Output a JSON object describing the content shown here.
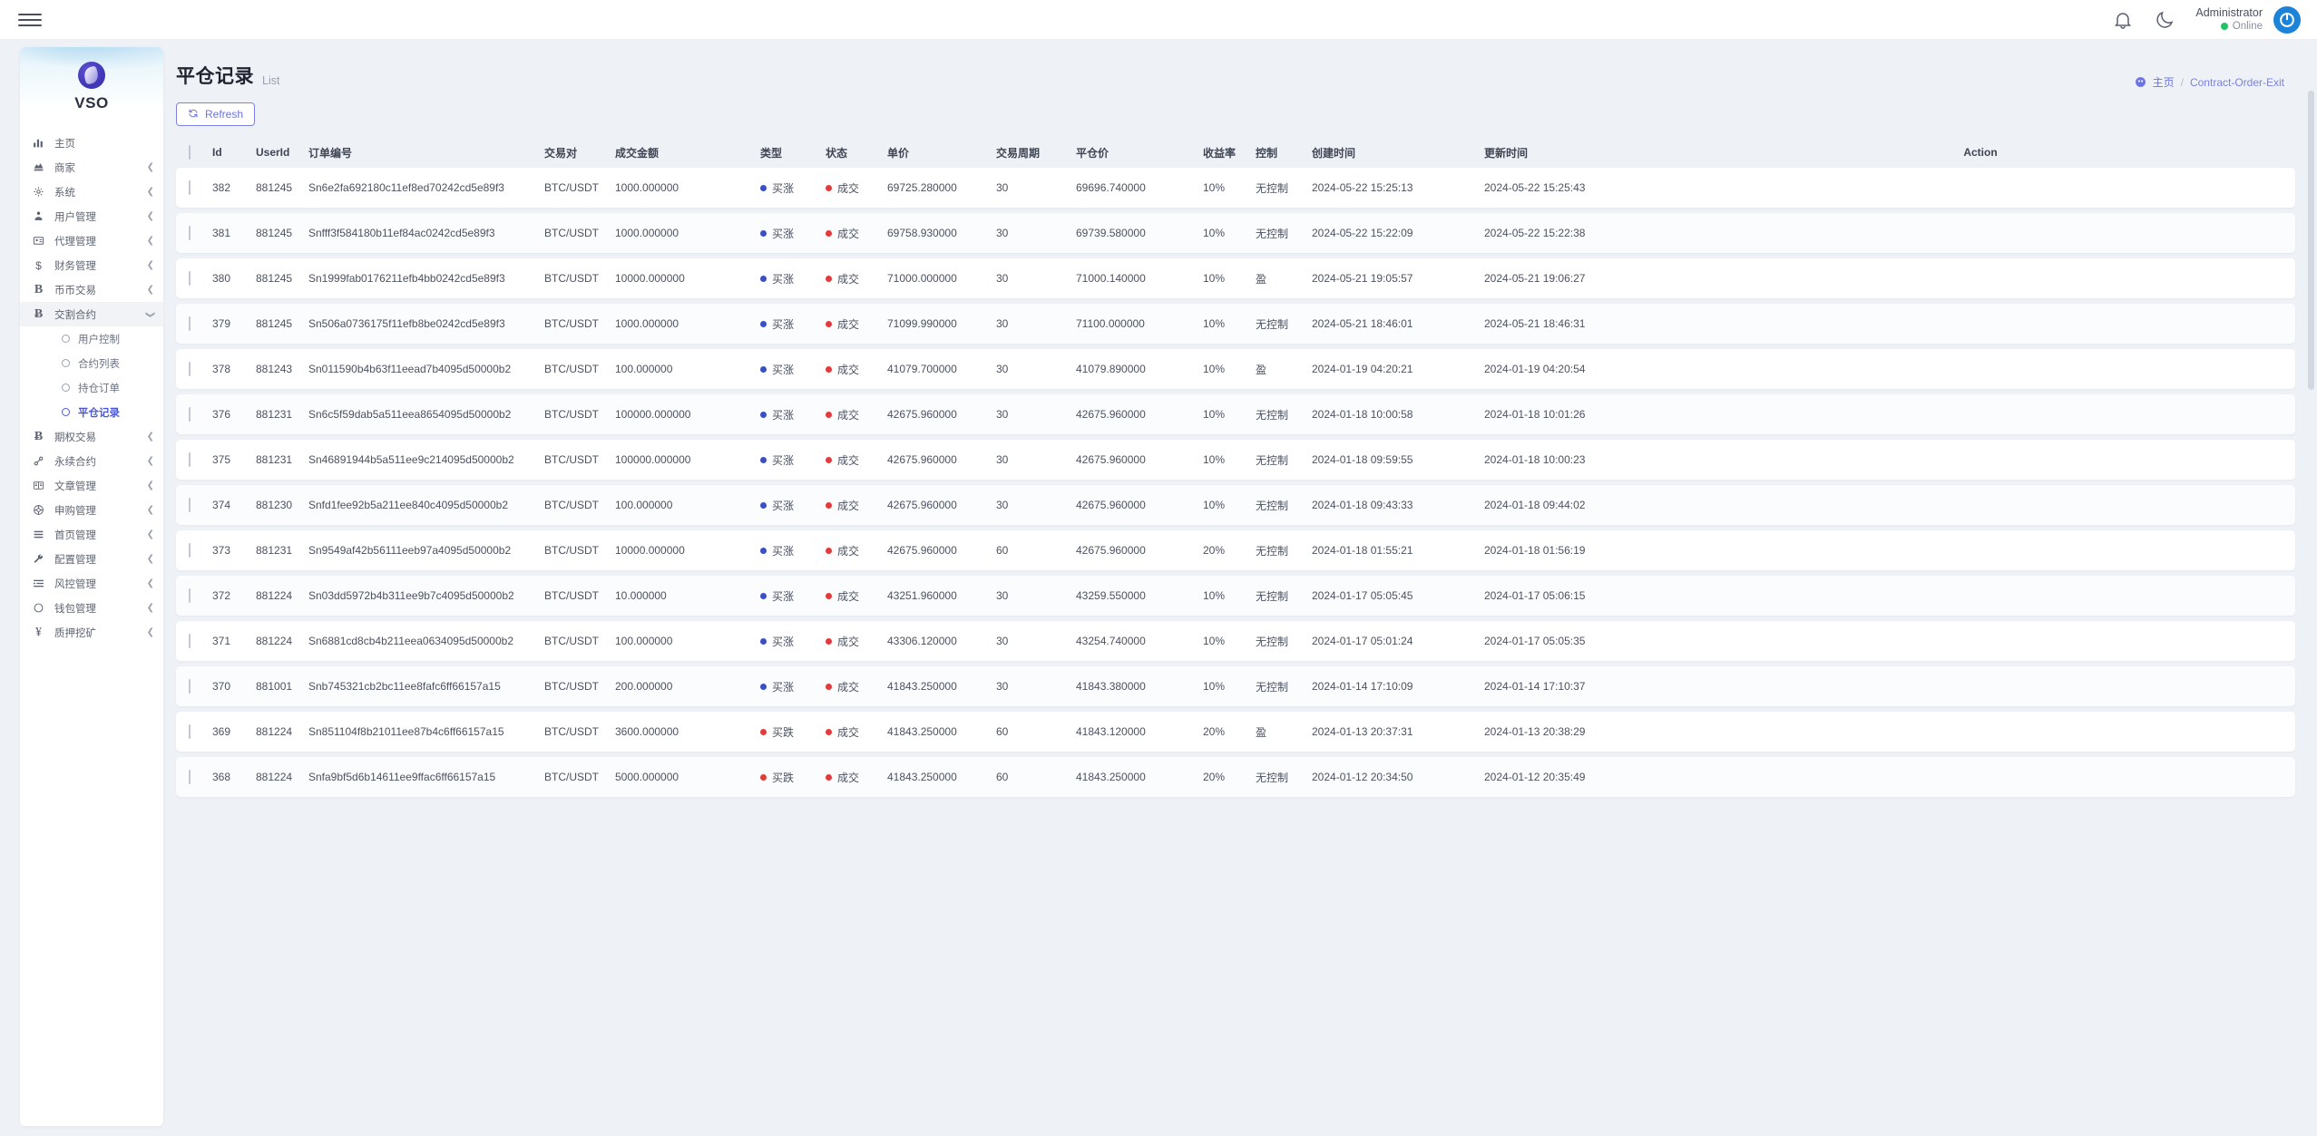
{
  "topbar": {
    "menu_toggle": "menu-toggle",
    "notification_icon": "bell-icon",
    "theme_icon": "moon-icon",
    "user_name": "Administrator",
    "user_status": "Online"
  },
  "sidebar": {
    "brand_name": "VSO",
    "items": [
      {
        "label": "主页",
        "icon": "chart-bars-icon",
        "caret": false,
        "active": false
      },
      {
        "label": "商家",
        "icon": "merchant-icon",
        "caret": true,
        "active": false
      },
      {
        "label": "系统",
        "icon": "gear-icon",
        "caret": true,
        "active": false
      },
      {
        "label": "用户管理",
        "icon": "user-manage-icon",
        "caret": true,
        "active": false
      },
      {
        "label": "代理管理",
        "icon": "id-card-icon",
        "caret": true,
        "active": false
      },
      {
        "label": "财务管理",
        "icon": "dollar-icon",
        "caret": true,
        "active": false
      },
      {
        "label": "币币交易",
        "icon": "letter-b-icon",
        "caret": true,
        "active": false
      },
      {
        "label": "交割合约",
        "icon": "bitcoin-icon",
        "caret": true,
        "active": true
      },
      {
        "label": "期权交易",
        "icon": "bitcoin-icon",
        "caret": true,
        "active": false
      },
      {
        "label": "永续合约",
        "icon": "link-icon",
        "caret": true,
        "active": false
      },
      {
        "label": "文章管理",
        "icon": "article-icon",
        "caret": true,
        "active": false
      },
      {
        "label": "申购管理",
        "icon": "circle-dot-icon",
        "caret": true,
        "active": false
      },
      {
        "label": "首页管理",
        "icon": "lines-icon",
        "caret": true,
        "active": false
      },
      {
        "label": "配置管理",
        "icon": "wrench-icon",
        "caret": true,
        "active": false
      },
      {
        "label": "风控管理",
        "icon": "list-indent-icon",
        "caret": true,
        "active": false
      },
      {
        "label": "钱包管理",
        "icon": "circle-icon",
        "caret": true,
        "active": false
      },
      {
        "label": "质押挖矿",
        "icon": "yen-icon",
        "caret": true,
        "active": false
      }
    ],
    "submenu": [
      {
        "label": "用户控制",
        "active": false
      },
      {
        "label": "合约列表",
        "active": false
      },
      {
        "label": "持仓订单",
        "active": false
      },
      {
        "label": "平仓记录",
        "active": true
      }
    ]
  },
  "page": {
    "title": "平仓记录",
    "subtitle": "List",
    "breadcrumb_home": "主页",
    "breadcrumb_sep": "/",
    "breadcrumb_current": "Contract-Order-Exit",
    "refresh_label": "Refresh"
  },
  "table": {
    "headers": {
      "id": "Id",
      "user_id": "UserId",
      "order_no": "订单编号",
      "pair": "交易对",
      "amount": "成交金额",
      "type": "类型",
      "state": "状态",
      "price": "单价",
      "period": "交易周期",
      "close_price": "平仓价",
      "rate": "收益率",
      "control": "控制",
      "created": "创建时间",
      "updated": "更新时间",
      "action": "Action"
    },
    "colors": {
      "buy_up": "#3b4fc4",
      "buy_down": "#e23b3b",
      "state_done": "#e23b3b",
      "accent": "#6d74e0"
    },
    "rows": [
      {
        "id": "382",
        "user_id": "881245",
        "order_no": "Sn6e2fa692180c11ef8ed70242cd5e89f3",
        "pair": "BTC/USDT",
        "amount": "1000.000000",
        "type": "买涨",
        "type_dir": "up",
        "state": "成交",
        "price": "69725.280000",
        "period": "30",
        "close_price": "69696.740000",
        "rate": "10%",
        "control": "无控制",
        "created": "2024-05-22 15:25:13",
        "updated": "2024-05-22 15:25:43"
      },
      {
        "id": "381",
        "user_id": "881245",
        "order_no": "Snfff3f584180b11ef84ac0242cd5e89f3",
        "pair": "BTC/USDT",
        "amount": "1000.000000",
        "type": "买涨",
        "type_dir": "up",
        "state": "成交",
        "price": "69758.930000",
        "period": "30",
        "close_price": "69739.580000",
        "rate": "10%",
        "control": "无控制",
        "created": "2024-05-22 15:22:09",
        "updated": "2024-05-22 15:22:38"
      },
      {
        "id": "380",
        "user_id": "881245",
        "order_no": "Sn1999fab0176211efb4bb0242cd5e89f3",
        "pair": "BTC/USDT",
        "amount": "10000.000000",
        "type": "买涨",
        "type_dir": "up",
        "state": "成交",
        "price": "71000.000000",
        "period": "30",
        "close_price": "71000.140000",
        "rate": "10%",
        "control": "盈",
        "created": "2024-05-21 19:05:57",
        "updated": "2024-05-21 19:06:27"
      },
      {
        "id": "379",
        "user_id": "881245",
        "order_no": "Sn506a0736175f11efb8be0242cd5e89f3",
        "pair": "BTC/USDT",
        "amount": "1000.000000",
        "type": "买涨",
        "type_dir": "up",
        "state": "成交",
        "price": "71099.990000",
        "period": "30",
        "close_price": "71100.000000",
        "rate": "10%",
        "control": "无控制",
        "created": "2024-05-21 18:46:01",
        "updated": "2024-05-21 18:46:31"
      },
      {
        "id": "378",
        "user_id": "881243",
        "order_no": "Sn011590b4b63f11eead7b4095d50000b2",
        "pair": "BTC/USDT",
        "amount": "100.000000",
        "type": "买涨",
        "type_dir": "up",
        "state": "成交",
        "price": "41079.700000",
        "period": "30",
        "close_price": "41079.890000",
        "rate": "10%",
        "control": "盈",
        "created": "2024-01-19 04:20:21",
        "updated": "2024-01-19 04:20:54"
      },
      {
        "id": "376",
        "user_id": "881231",
        "order_no": "Sn6c5f59dab5a511eea8654095d50000b2",
        "pair": "BTC/USDT",
        "amount": "100000.000000",
        "type": "买涨",
        "type_dir": "up",
        "state": "成交",
        "price": "42675.960000",
        "period": "30",
        "close_price": "42675.960000",
        "rate": "10%",
        "control": "无控制",
        "created": "2024-01-18 10:00:58",
        "updated": "2024-01-18 10:01:26"
      },
      {
        "id": "375",
        "user_id": "881231",
        "order_no": "Sn46891944b5a511ee9c214095d50000b2",
        "pair": "BTC/USDT",
        "amount": "100000.000000",
        "type": "买涨",
        "type_dir": "up",
        "state": "成交",
        "price": "42675.960000",
        "period": "30",
        "close_price": "42675.960000",
        "rate": "10%",
        "control": "无控制",
        "created": "2024-01-18 09:59:55",
        "updated": "2024-01-18 10:00:23"
      },
      {
        "id": "374",
        "user_id": "881230",
        "order_no": "Snfd1fee92b5a211ee840c4095d50000b2",
        "pair": "BTC/USDT",
        "amount": "100.000000",
        "type": "买涨",
        "type_dir": "up",
        "state": "成交",
        "price": "42675.960000",
        "period": "30",
        "close_price": "42675.960000",
        "rate": "10%",
        "control": "无控制",
        "created": "2024-01-18 09:43:33",
        "updated": "2024-01-18 09:44:02"
      },
      {
        "id": "373",
        "user_id": "881231",
        "order_no": "Sn9549af42b56111eeb97a4095d50000b2",
        "pair": "BTC/USDT",
        "amount": "10000.000000",
        "type": "买涨",
        "type_dir": "up",
        "state": "成交",
        "price": "42675.960000",
        "period": "60",
        "close_price": "42675.960000",
        "rate": "20%",
        "control": "无控制",
        "created": "2024-01-18 01:55:21",
        "updated": "2024-01-18 01:56:19"
      },
      {
        "id": "372",
        "user_id": "881224",
        "order_no": "Sn03dd5972b4b311ee9b7c4095d50000b2",
        "pair": "BTC/USDT",
        "amount": "10.000000",
        "type": "买涨",
        "type_dir": "up",
        "state": "成交",
        "price": "43251.960000",
        "period": "30",
        "close_price": "43259.550000",
        "rate": "10%",
        "control": "无控制",
        "created": "2024-01-17 05:05:45",
        "updated": "2024-01-17 05:06:15"
      },
      {
        "id": "371",
        "user_id": "881224",
        "order_no": "Sn6881cd8cb4b211eea0634095d50000b2",
        "pair": "BTC/USDT",
        "amount": "100.000000",
        "type": "买涨",
        "type_dir": "up",
        "state": "成交",
        "price": "43306.120000",
        "period": "30",
        "close_price": "43254.740000",
        "rate": "10%",
        "control": "无控制",
        "created": "2024-01-17 05:01:24",
        "updated": "2024-01-17 05:05:35"
      },
      {
        "id": "370",
        "user_id": "881001",
        "order_no": "Snb745321cb2bc11ee8fafc6ff66157a15",
        "pair": "BTC/USDT",
        "amount": "200.000000",
        "type": "买涨",
        "type_dir": "up",
        "state": "成交",
        "price": "41843.250000",
        "period": "30",
        "close_price": "41843.380000",
        "rate": "10%",
        "control": "无控制",
        "created": "2024-01-14 17:10:09",
        "updated": "2024-01-14 17:10:37"
      },
      {
        "id": "369",
        "user_id": "881224",
        "order_no": "Sn851104f8b21011ee87b4c6ff66157a15",
        "pair": "BTC/USDT",
        "amount": "3600.000000",
        "type": "买跌",
        "type_dir": "down",
        "state": "成交",
        "price": "41843.250000",
        "period": "60",
        "close_price": "41843.120000",
        "rate": "20%",
        "control": "盈",
        "created": "2024-01-13 20:37:31",
        "updated": "2024-01-13 20:38:29"
      },
      {
        "id": "368",
        "user_id": "881224",
        "order_no": "Snfa9bf5d6b14611ee9ffac6ff66157a15",
        "pair": "BTC/USDT",
        "amount": "5000.000000",
        "type": "买跌",
        "type_dir": "down",
        "state": "成交",
        "price": "41843.250000",
        "period": "60",
        "close_price": "41843.250000",
        "rate": "20%",
        "control": "无控制",
        "created": "2024-01-12 20:34:50",
        "updated": "2024-01-12 20:35:49"
      }
    ]
  }
}
